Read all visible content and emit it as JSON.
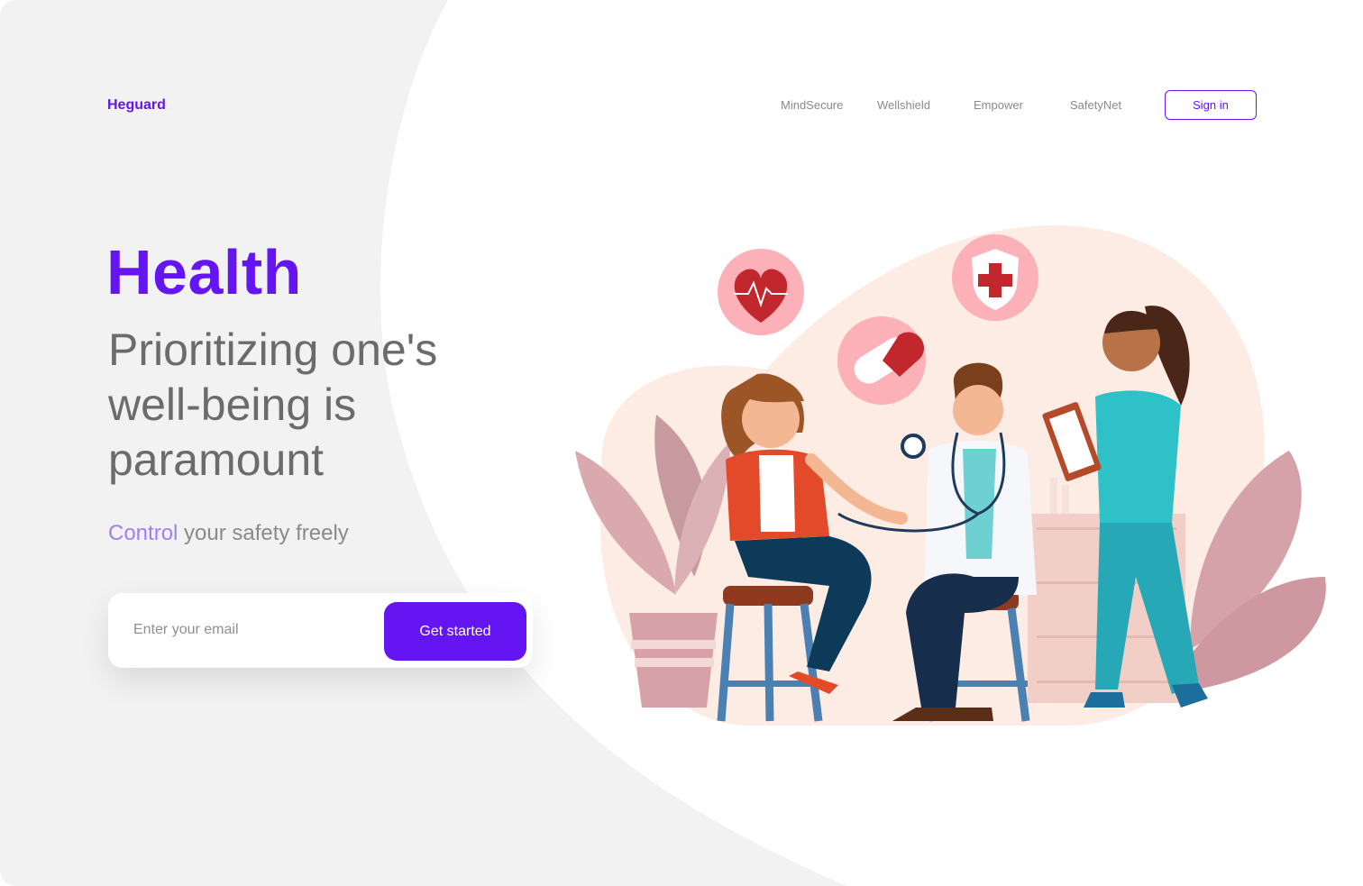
{
  "brand": {
    "name": "Heguard",
    "accent": "#6514f2"
  },
  "nav": {
    "links": [
      "MindSecure",
      "Wellshield",
      "Empower",
      "SafetyNet"
    ],
    "signin_label": "Sign in"
  },
  "hero": {
    "title": "Health",
    "subtitle": "Prioritizing one's well-being is paramount",
    "tagline_accent": "Control",
    "tagline_rest": " your safety freely"
  },
  "signup": {
    "email_placeholder": "Enter your email",
    "cta_label": "Get started"
  },
  "illustration": {
    "icons": [
      "heartbeat-icon",
      "pill-icon",
      "medical-shield-icon"
    ],
    "scene": "doctor-consultation-illustration"
  }
}
